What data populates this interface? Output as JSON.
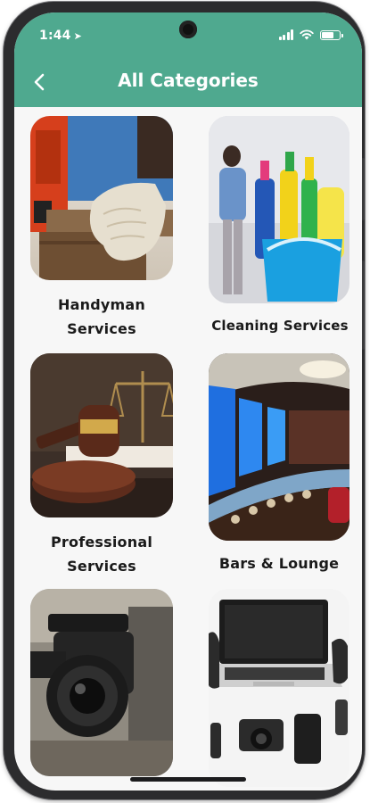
{
  "status": {
    "time": "1:44",
    "battery_level": 0.68
  },
  "header": {
    "title": "All Categories",
    "back_icon": "chevron-left-icon"
  },
  "categories": [
    {
      "label": "Handyman\nServices",
      "image": "handyman-photo"
    },
    {
      "label": "Cleaning Services",
      "image": "cleaning-photo"
    },
    {
      "label": "Professional\nServices",
      "image": "professional-photo"
    },
    {
      "label": "Bars & Lounge",
      "image": "bar-photo"
    },
    {
      "label": "",
      "image": "camera-photo"
    },
    {
      "label": "",
      "image": "electronics-photo"
    }
  ],
  "colors": {
    "header": "#4fa98f",
    "background": "#f7f7f7",
    "label": "#1a1a1a"
  }
}
